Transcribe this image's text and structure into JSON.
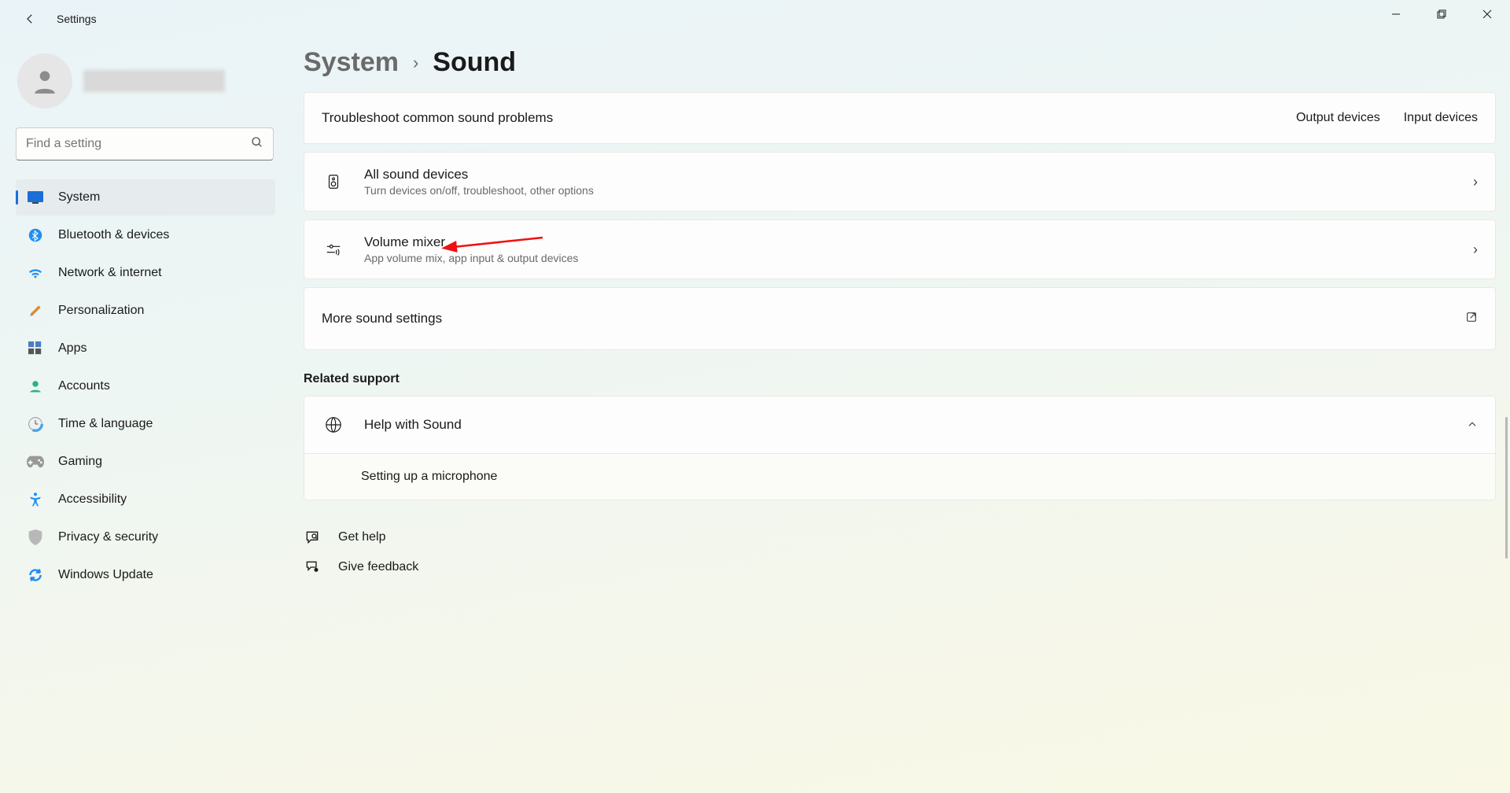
{
  "app": {
    "title": "Settings"
  },
  "search": {
    "placeholder": "Find a setting"
  },
  "nav": {
    "items": [
      {
        "label": "System"
      },
      {
        "label": "Bluetooth & devices"
      },
      {
        "label": "Network & internet"
      },
      {
        "label": "Personalization"
      },
      {
        "label": "Apps"
      },
      {
        "label": "Accounts"
      },
      {
        "label": "Time & language"
      },
      {
        "label": "Gaming"
      },
      {
        "label": "Accessibility"
      },
      {
        "label": "Privacy & security"
      },
      {
        "label": "Windows Update"
      }
    ]
  },
  "breadcrumb": {
    "parent": "System",
    "current": "Sound"
  },
  "troubleshoot": {
    "label": "Troubleshoot common sound problems",
    "output": "Output devices",
    "input": "Input devices"
  },
  "all_devices": {
    "title": "All sound devices",
    "sub": "Turn devices on/off, troubleshoot, other options"
  },
  "mixer": {
    "title": "Volume mixer",
    "sub": "App volume mix, app input & output devices"
  },
  "more": {
    "title": "More sound settings"
  },
  "related": {
    "header": "Related support"
  },
  "help": {
    "title": "Help with Sound",
    "item1": "Setting up a microphone"
  },
  "links": {
    "help": "Get help",
    "feedback": "Give feedback"
  }
}
